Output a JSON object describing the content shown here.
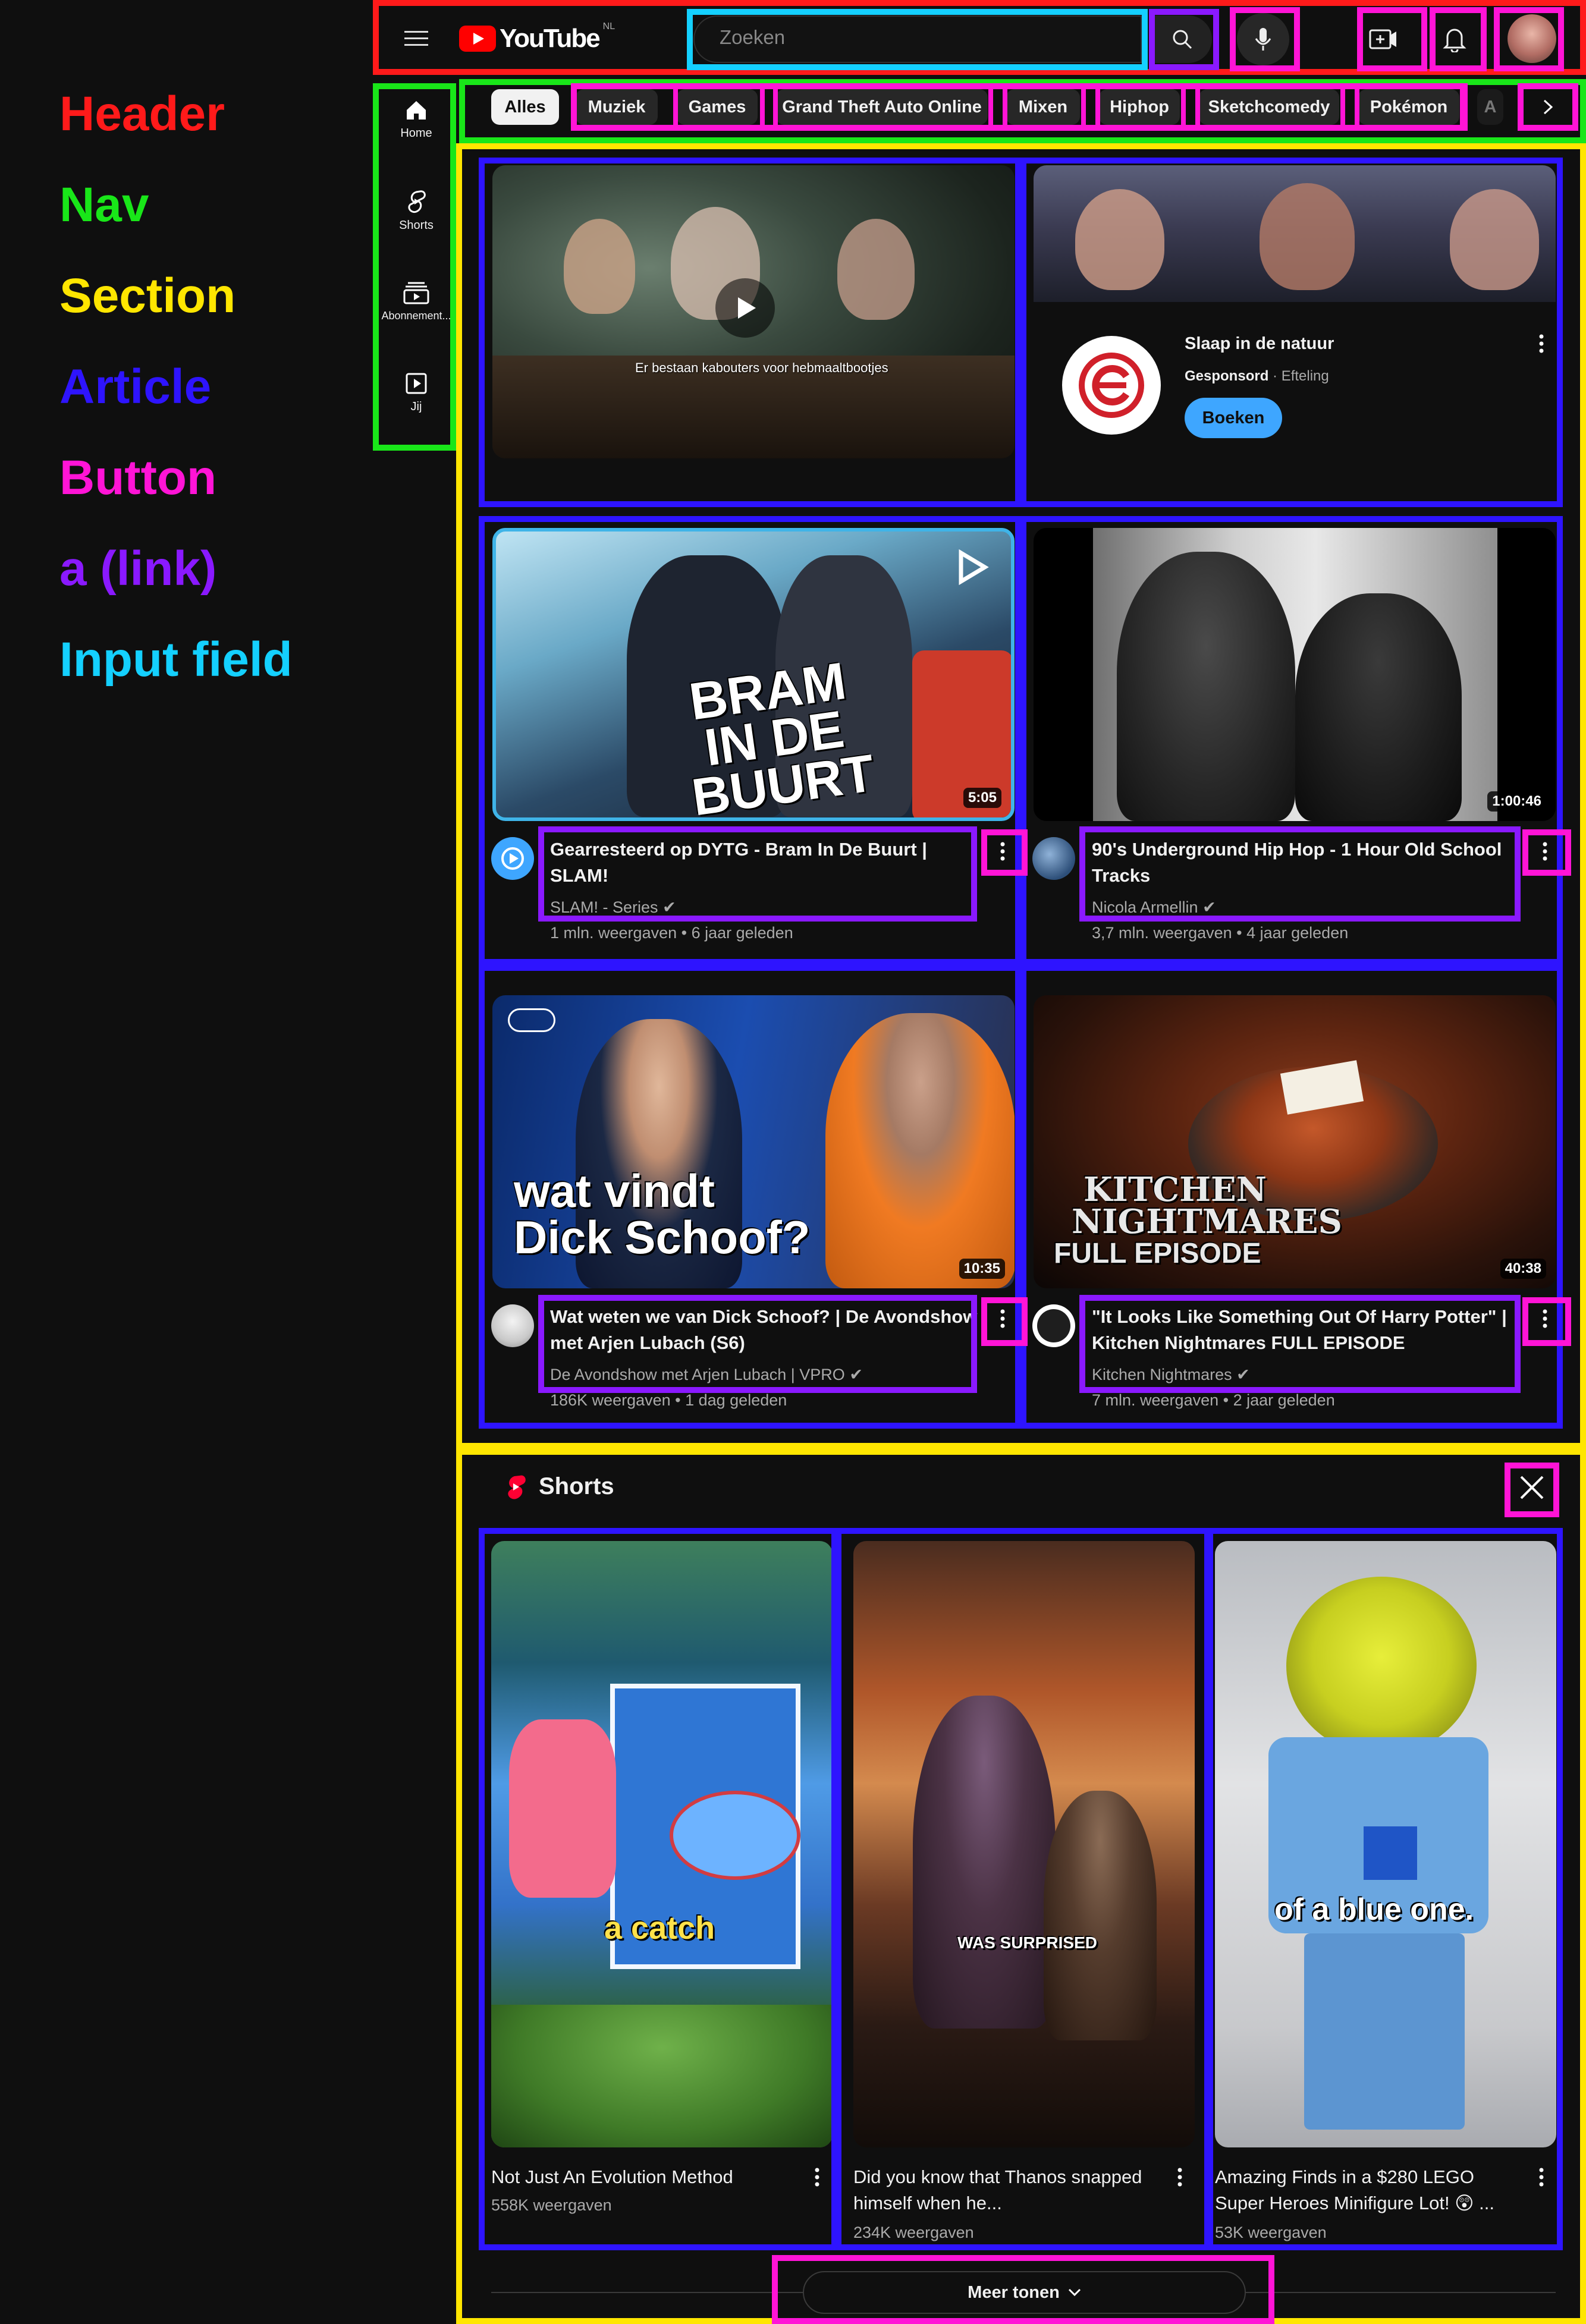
{
  "legend": {
    "header": "Header",
    "nav": "Nav",
    "section": "Section",
    "article": "Article",
    "button": "Button",
    "link": "a (link)",
    "input": "Input field"
  },
  "colors": {
    "header": "#ff1a1a",
    "nav": "#19e619",
    "section": "#ffe600",
    "article": "#2e14ff",
    "button": "#ff14d6",
    "link": "#8a19ff",
    "input": "#14d0ff",
    "youtube_red": "#ff0000",
    "background": "#0f0f0f"
  },
  "header": {
    "logo_text": "YouTube",
    "country_code": "NL",
    "search_placeholder": "Zoeken",
    "icons": [
      "menu-icon",
      "search-icon",
      "microphone-icon",
      "create-icon",
      "bell-icon",
      "avatar"
    ]
  },
  "nav": {
    "items": [
      {
        "label": "Home",
        "icon": "home-icon"
      },
      {
        "label": "Shorts",
        "icon": "shorts-icon"
      },
      {
        "label": "Abonnement...",
        "icon": "subscriptions-icon"
      },
      {
        "label": "Jij",
        "icon": "you-icon"
      }
    ]
  },
  "chips": [
    "Alles",
    "Muziek",
    "Games",
    "Grand Theft Auto Online",
    "Mixen",
    "Hiphop",
    "Sketchcomedy",
    "Pokémon",
    "A"
  ],
  "ad": {
    "title": "Slaap in de natuur",
    "sponsored": "Gesponsord",
    "advertiser": "Efteling",
    "cta": "Boeken",
    "overlay_caption": "Er bestaan kabouters voor hebmaaltbootjes"
  },
  "videos": [
    {
      "title_line1": "Gearresteerd op DYTG - Bram In De Buurt |",
      "title_line2": "SLAM!",
      "channel": "SLAM! - Series",
      "meta": "1 mln. weergaven • 6 jaar geleden",
      "duration": "5:05",
      "overlay": "BRAM IN DE BUURT"
    },
    {
      "title_line1": "90's Underground Hip Hop - 1 Hour Old School",
      "title_line2": "Tracks",
      "channel": "Nicola Armellin",
      "meta": "3,7 mln. weergaven • 4 jaar geleden",
      "duration": "1:00:46"
    },
    {
      "title_line1": "Wat weten we van Dick Schoof? | De Avondshow",
      "title_line2": "met Arjen Lubach (S6)",
      "channel": "De Avondshow met Arjen Lubach | VPRO",
      "meta": "186K weergaven • 1 dag geleden",
      "duration": "10:35",
      "overlay_line1": "wat vindt",
      "overlay_line2": "Dick Schoof?"
    },
    {
      "title_line1": "\"It Looks Like Something Out Of Harry Potter\" |",
      "title_line2": "Kitchen Nightmares FULL EPISODE",
      "channel": "Kitchen Nightmares",
      "meta": "7 mln. weergaven • 2 jaar geleden",
      "duration": "40:38",
      "overlay_line1": "KITCHEN",
      "overlay_line2": "NIGHTMARES",
      "overlay_line3": "FULL EPISODE"
    }
  ],
  "shorts": {
    "heading": "Shorts",
    "items": [
      {
        "title_line1": "Not Just An Evolution Method",
        "title_line2": "",
        "views": "558K weergaven",
        "overlay": "a catch"
      },
      {
        "title_line1": "Did you know that Thanos snapped",
        "title_line2": "himself when he...",
        "views": "234K weergaven",
        "overlay": "WAS SURPRISED"
      },
      {
        "title_line1": "Amazing Finds in a $280 LEGO",
        "title_line2": "Super Heroes Minifigure Lot! 😲 ...",
        "views": "53K weergaven",
        "overlay": "of a blue one."
      }
    ],
    "more_button": "Meer tonen"
  }
}
